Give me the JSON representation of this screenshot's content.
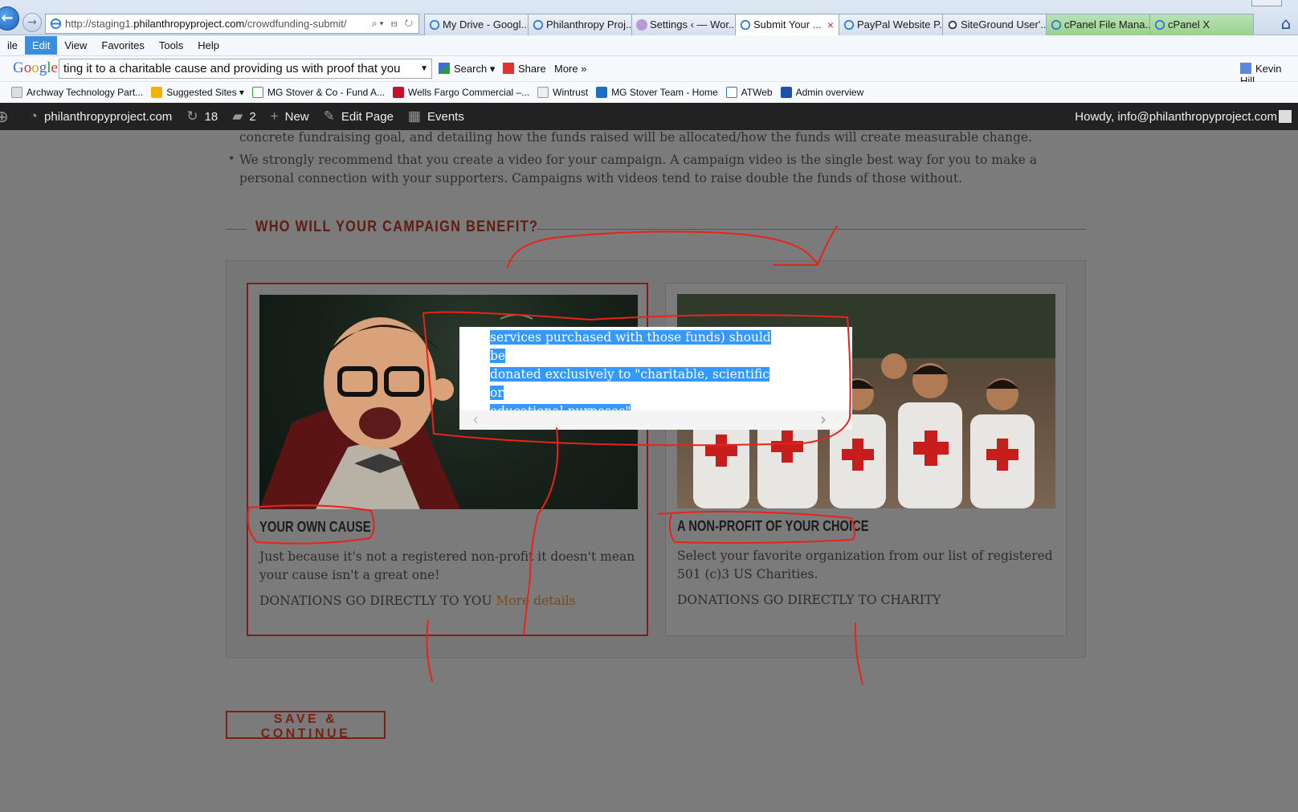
{
  "browser": {
    "address": {
      "prefix": "http://staging1.",
      "host": "philanthropyproject.com",
      "path": "/crowdfunding-submit/"
    },
    "tabs": [
      {
        "label": "My Drive - Googl..."
      },
      {
        "label": "Philanthropy Proj..."
      },
      {
        "label": "Settings ‹ — Wor..."
      },
      {
        "label": "Submit Your ..."
      },
      {
        "label": "PayPal Website P..."
      },
      {
        "label": "SiteGround User'..."
      },
      {
        "label": "cPanel File Mana..."
      },
      {
        "label": "cPanel X"
      }
    ],
    "menu": [
      "ile",
      "Edit",
      "View",
      "Favorites",
      "Tools",
      "Help"
    ],
    "google_bar": {
      "logo": "Google",
      "query": "ting it to a charitable cause and providing us with proof that you",
      "search_label": "Search",
      "share_label": "Share",
      "more_label": "More »",
      "user": "Kevin Hill"
    },
    "favorites": [
      "Archway Technology Part...",
      "Suggested Sites",
      "MG Stover & Co - Fund A...",
      "Wells Fargo Commercial –...",
      "Wintrust",
      "MG Stover Team - Home",
      "ATWeb",
      "Admin overview"
    ]
  },
  "adminbar": {
    "site": "philanthropyproject.com",
    "updates": "18",
    "comments": "2",
    "new_label": "New",
    "edit_label": "Edit Page",
    "events_label": "Events",
    "howdy": "Howdy, info@philanthropyproject.com"
  },
  "content": {
    "bullet1_tail": "concrete fundraising goal, and detailing how the funds raised will be allocated/how the funds will create measurable change.",
    "bullet2": "We strongly recommend that you create a video for your campaign. A campaign video is the single best way for you to make a personal connection with your supporters. Campaigns with videos tend to raise double the funds of those without.",
    "section_title": "WHO WILL YOUR CAMPAIGN BENEFIT?",
    "options": [
      {
        "title": "YOUR OWN CAUSE",
        "description": "Just because it's not a registered non-profit it doesn't mean your cause isn't a great one!",
        "footer": "DONATIONS GO DIRECTLY TO YOU",
        "link": "More details"
      },
      {
        "title": "A NON-PROFIT OF YOUR CHOICE",
        "description": "Select your favorite organization from our list of registered 501 (c)3 US Charities.",
        "footer": "DONATIONS GO DIRECTLY TO CHARITY"
      }
    ],
    "save_button": "SAVE & CONTINUE"
  },
  "modal": {
    "line1": "services purchased with those funds) should be",
    "line2": "donated exclusively to \"charitable, scientific or",
    "line3": "educational purposes\"",
    "prev_icon": "‹",
    "next_icon": "›"
  },
  "colors": {
    "accent": "#7a2114",
    "annotation": "#e8231a",
    "selection": "#3399ff",
    "adminbar": "#222222"
  }
}
